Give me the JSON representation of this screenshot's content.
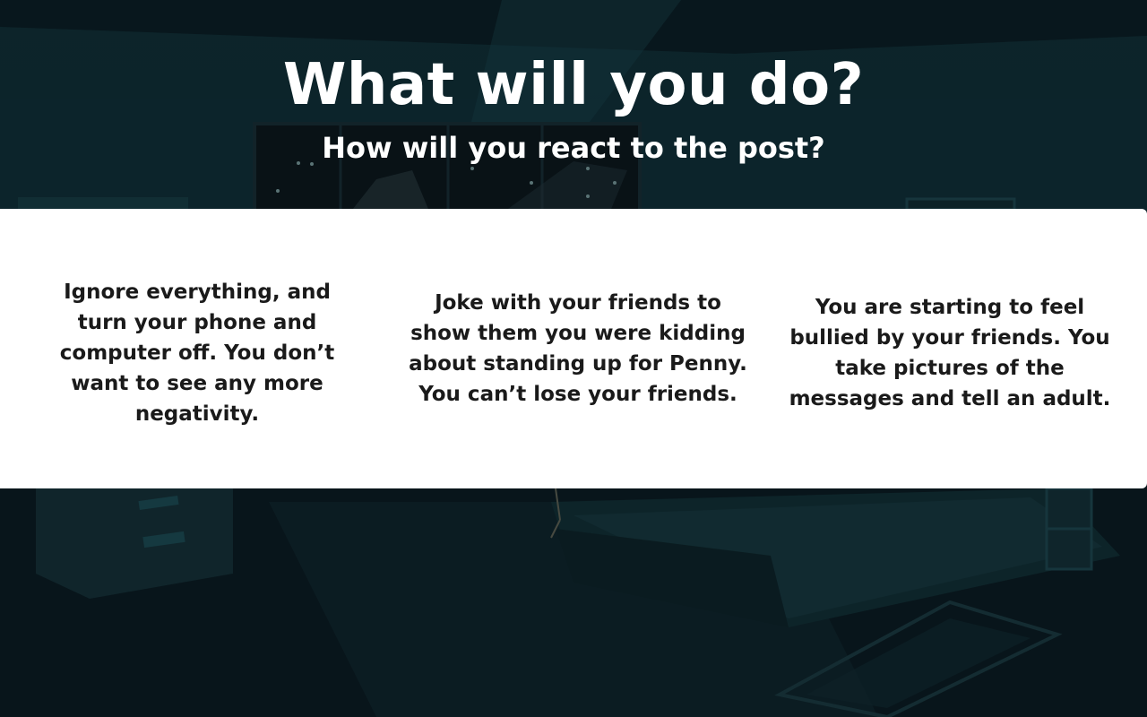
{
  "header": {
    "title": "What will you do?",
    "subtitle": "How will you react to the post?"
  },
  "choices": [
    {
      "text": "Ignore everything, and turn your phone and computer off. You don’t want to see any more negativity."
    },
    {
      "text": "Joke with your friends to show them you were kidding about standing up for Penny. You can’t lose your friends."
    },
    {
      "text": "You are starting to feel bullied by your friends. You take pictures of the messages and tell an adult."
    }
  ],
  "colors": {
    "background": "#0d2328",
    "panel": "#ffffff",
    "title_text": "#ffffff",
    "choice_text": "#1a1a1a"
  }
}
